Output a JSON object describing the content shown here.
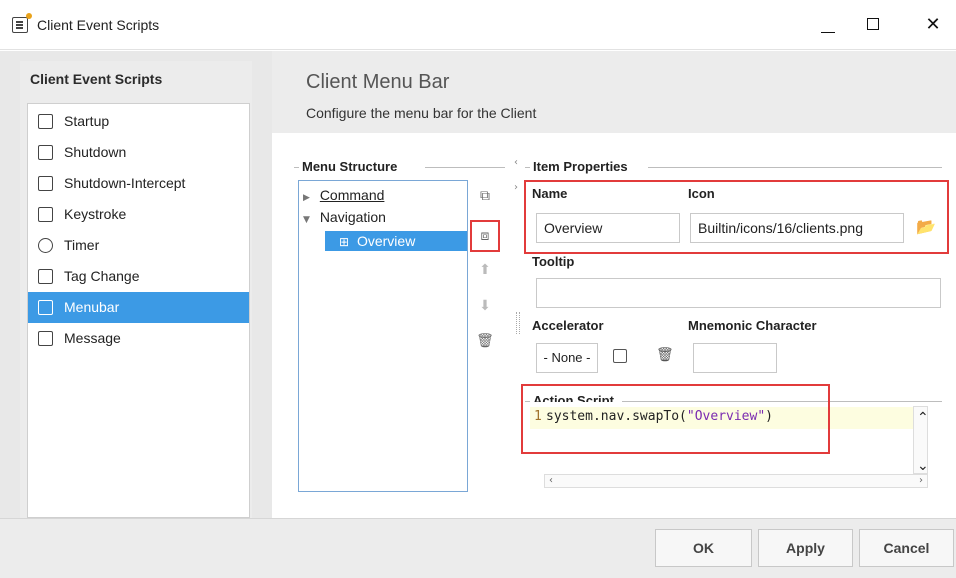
{
  "window": {
    "title": "Client Event Scripts"
  },
  "sidebar": {
    "title": "Client Event Scripts",
    "items": [
      {
        "label": "Startup",
        "icon": "startup-icon"
      },
      {
        "label": "Shutdown",
        "icon": "shutdown-icon"
      },
      {
        "label": "Shutdown-Intercept",
        "icon": "shutdown-intercept-icon"
      },
      {
        "label": "Keystroke",
        "icon": "keystroke-icon"
      },
      {
        "label": "Timer",
        "icon": "timer-icon"
      },
      {
        "label": "Tag Change",
        "icon": "tag-change-icon"
      },
      {
        "label": "Menubar",
        "icon": "menubar-icon",
        "selected": true
      },
      {
        "label": "Message",
        "icon": "message-icon"
      }
    ]
  },
  "header": {
    "title": "Client Menu Bar",
    "subtitle": "Configure the menu bar for the Client"
  },
  "menu_structure": {
    "label": "Menu Structure",
    "items": [
      {
        "label": "Command",
        "level": 0
      },
      {
        "label": "Navigation",
        "level": 0
      },
      {
        "label": "Overview",
        "level": 1,
        "selected": true
      }
    ]
  },
  "item_properties": {
    "label": "Item Properties",
    "name_label": "Name",
    "name_value": "Overview",
    "icon_label": "Icon",
    "icon_value": "Builtin/icons/16/clients.png",
    "tooltip_label": "Tooltip",
    "tooltip_value": "",
    "accelerator_label": "Accelerator",
    "accelerator_value": "- None -",
    "mnemonic_label": "Mnemonic Character",
    "mnemonic_value": ""
  },
  "action_script": {
    "label": "Action Script",
    "line_number": "1",
    "code_prefix": "system.nav.swapTo(",
    "code_string": "\"Overview\"",
    "code_suffix": ")"
  },
  "footer": {
    "ok": "OK",
    "apply": "Apply",
    "cancel": "Cancel"
  },
  "colors": {
    "selection": "#3c9ae5",
    "highlight_box": "#e23b3b",
    "code_string": "#7a2bb0"
  }
}
